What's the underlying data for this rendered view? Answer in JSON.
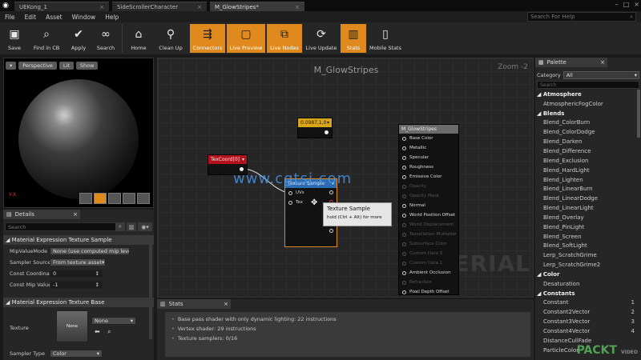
{
  "tabs": [
    {
      "label": "UEKong_1"
    },
    {
      "label": "SideScrollerCharacter"
    },
    {
      "label": "M_GlowStripes*"
    }
  ],
  "menu": [
    "File",
    "Edit",
    "Asset",
    "Window",
    "Help"
  ],
  "help_search_placeholder": "Search For Help",
  "toolbar": [
    {
      "label": "Save",
      "icon": "save-icon",
      "active": false
    },
    {
      "label": "Find in CB",
      "icon": "magnifier-icon",
      "active": false
    },
    {
      "label": "Apply",
      "icon": "checkmark-icon",
      "active": false
    },
    {
      "label": "Search",
      "icon": "binoculars-icon",
      "active": false
    },
    {
      "label": "Home",
      "icon": "home-icon",
      "active": false
    },
    {
      "label": "Clean Up",
      "icon": "broom-icon",
      "active": false
    },
    {
      "label": "Connectors",
      "icon": "connectors-icon",
      "active": true
    },
    {
      "label": "Live Preview",
      "icon": "tv-icon",
      "active": true
    },
    {
      "label": "Live Nodes",
      "icon": "nodes-icon",
      "active": true
    },
    {
      "label": "Live Update",
      "icon": "refresh-icon",
      "active": false
    },
    {
      "label": "Stats",
      "icon": "bar-chart-icon",
      "active": true
    },
    {
      "label": "Mobile Stats",
      "icon": "mobile-icon",
      "active": false
    }
  ],
  "viewport": {
    "perspective": "Perspective",
    "lit": "Lit",
    "show": "Show",
    "axes": "Y-X"
  },
  "details": {
    "tab": "Details",
    "search_placeholder": "Search",
    "section1": "Material Expression Texture Sample",
    "props": [
      {
        "label": "MipValueMode",
        "value": "None (use computed mip level)"
      },
      {
        "label": "Sampler Source",
        "value": "From texture asset"
      },
      {
        "label": "Const Coordinate",
        "value": "0"
      },
      {
        "label": "Const Mip Value",
        "value": "-1"
      }
    ],
    "section2": "Material Expression Texture Base",
    "texture_label": "Texture",
    "texture_thumb": "None",
    "texture_value": "None",
    "sampler_type_label": "Sampler Type",
    "sampler_type_value": "Color"
  },
  "graph": {
    "title": "M_GlowStripes",
    "zoom": "Zoom -2",
    "watermark": "MATERIAL",
    "site_watermark": "www.cgtsj.com",
    "constant_node": "0.0987,1,0",
    "texcoord_node": "TexCoord[0]",
    "sample_node": {
      "title": "Texture Sample",
      "pins": [
        "UVs",
        "Tex"
      ]
    },
    "material_node": {
      "title": "M_GlowStripes",
      "pins": [
        {
          "label": "Base Color",
          "dim": false
        },
        {
          "label": "Metallic",
          "dim": false
        },
        {
          "label": "Specular",
          "dim": false
        },
        {
          "label": "Roughness",
          "dim": false
        },
        {
          "label": "Emissive Color",
          "dim": false
        },
        {
          "label": "Opacity",
          "dim": true
        },
        {
          "label": "Opacity Mask",
          "dim": true
        },
        {
          "label": "Normal",
          "dim": false
        },
        {
          "label": "World Position Offset",
          "dim": false
        },
        {
          "label": "World Displacement",
          "dim": true
        },
        {
          "label": "Tessellation Multiplier",
          "dim": true
        },
        {
          "label": "Subsurface Color",
          "dim": true
        },
        {
          "label": "Custom Data 0",
          "dim": true
        },
        {
          "label": "Custom Data 1",
          "dim": true
        },
        {
          "label": "Ambient Occlusion",
          "dim": false
        },
        {
          "label": "Refraction",
          "dim": true
        },
        {
          "label": "Pixel Depth Offset",
          "dim": false
        }
      ]
    },
    "tooltip": {
      "title": "Texture Sample",
      "hint": "hold (Ctrl + Alt) for more"
    }
  },
  "stats": {
    "tab": "Stats",
    "lines": [
      "Base pass shader with only dynamic lighting: 22 instructions",
      "Vertex shader: 29 instructions",
      "Texture samplers: 0/16"
    ]
  },
  "palette": {
    "tab": "Palette",
    "category_label": "Category",
    "category_value": "All",
    "search_placeholder": "Search",
    "items": [
      {
        "label": "Atmosphere",
        "cat": true,
        "key": ""
      },
      {
        "label": "AtmosphericFogColor",
        "cat": false,
        "key": ""
      },
      {
        "label": "Blends",
        "cat": true,
        "key": ""
      },
      {
        "label": "Blend_ColorBurn",
        "cat": false,
        "key": ""
      },
      {
        "label": "Blend_ColorDodge",
        "cat": false,
        "key": ""
      },
      {
        "label": "Blend_Darken",
        "cat": false,
        "key": ""
      },
      {
        "label": "Blend_Difference",
        "cat": false,
        "key": ""
      },
      {
        "label": "Blend_Exclusion",
        "cat": false,
        "key": ""
      },
      {
        "label": "Blend_HardLight",
        "cat": false,
        "key": ""
      },
      {
        "label": "Blend_Lighten",
        "cat": false,
        "key": ""
      },
      {
        "label": "Blend_LinearBurn",
        "cat": false,
        "key": ""
      },
      {
        "label": "Blend_LinearDodge",
        "cat": false,
        "key": ""
      },
      {
        "label": "Blend_LinearLight",
        "cat": false,
        "key": ""
      },
      {
        "label": "Blend_Overlay",
        "cat": false,
        "key": ""
      },
      {
        "label": "Blend_PinLight",
        "cat": false,
        "key": ""
      },
      {
        "label": "Blend_Screen",
        "cat": false,
        "key": ""
      },
      {
        "label": "Blend_SoftLight",
        "cat": false,
        "key": ""
      },
      {
        "label": "Lerp_ScratchGrime",
        "cat": false,
        "key": ""
      },
      {
        "label": "Lerp_ScratchGrime2",
        "cat": false,
        "key": ""
      },
      {
        "label": "Color",
        "cat": true,
        "key": ""
      },
      {
        "label": "Desaturation",
        "cat": false,
        "key": ""
      },
      {
        "label": "Constants",
        "cat": true,
        "key": ""
      },
      {
        "label": "Constant",
        "cat": false,
        "key": "1"
      },
      {
        "label": "Constant2Vector",
        "cat": false,
        "key": "2"
      },
      {
        "label": "Constant3Vector",
        "cat": false,
        "key": "3"
      },
      {
        "label": "Constant4Vector",
        "cat": false,
        "key": "4"
      },
      {
        "label": "DistanceCullFade",
        "cat": false,
        "key": ""
      },
      {
        "label": "ParticleColor",
        "cat": false,
        "key": ""
      }
    ],
    "brand": "PACKT",
    "brand_sub": "VIDEO"
  },
  "colors": {
    "accent": "#e08a1e",
    "constant_header": "#d9a51a",
    "texcoord_header": "#b3121b",
    "sample_header": "#2b6cb0",
    "material_header": "#6b6b6b"
  }
}
